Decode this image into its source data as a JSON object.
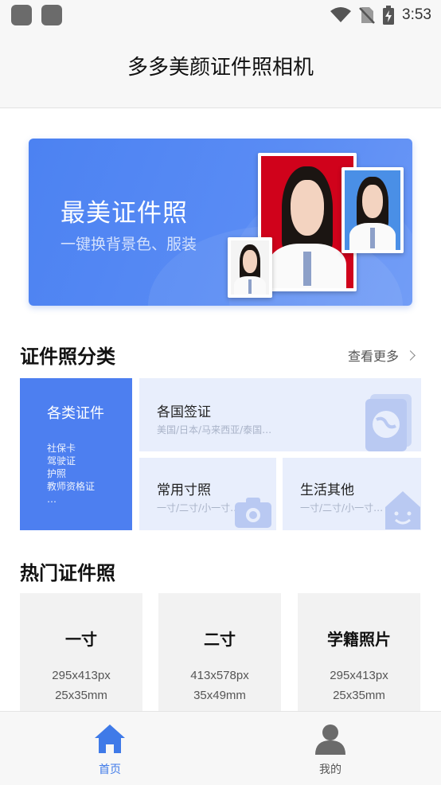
{
  "status_bar": {
    "time": "3:53"
  },
  "header": {
    "title": "多多美颜证件照相机"
  },
  "banner": {
    "title": "最美证件照",
    "subtitle": "一键换背景色、服装"
  },
  "categories_section": {
    "title": "证件照分类",
    "more_label": "查看更多",
    "main": {
      "title": "各类证件",
      "items": [
        "社保卡",
        "驾驶证",
        "护照",
        "教师资格证",
        "…"
      ]
    },
    "cards": [
      {
        "title": "各国签证",
        "subtitle": "美国/日本/马来西亚/泰国…"
      },
      {
        "title": "常用寸照",
        "subtitle": "一寸/二寸/小一寸…"
      },
      {
        "title": "生活其他",
        "subtitle": "一寸/二寸/小一寸…"
      }
    ]
  },
  "popular_section": {
    "title": "热门证件照",
    "cards": [
      {
        "title": "一寸",
        "pixels": "295x413px",
        "size": "25x35mm"
      },
      {
        "title": "二寸",
        "pixels": "413x578px",
        "size": "35x49mm"
      },
      {
        "title": "学籍照片",
        "pixels": "295x413px",
        "size": "25x35mm"
      }
    ]
  },
  "bottom_nav": {
    "items": [
      {
        "label": "首页",
        "icon": "home-icon",
        "active": true
      },
      {
        "label": "我的",
        "icon": "user-icon",
        "active": false
      }
    ]
  },
  "colors": {
    "accent": "#4d7ff0",
    "active_nav": "#3f7ae8",
    "inactive_nav": "#6b6b6b"
  }
}
